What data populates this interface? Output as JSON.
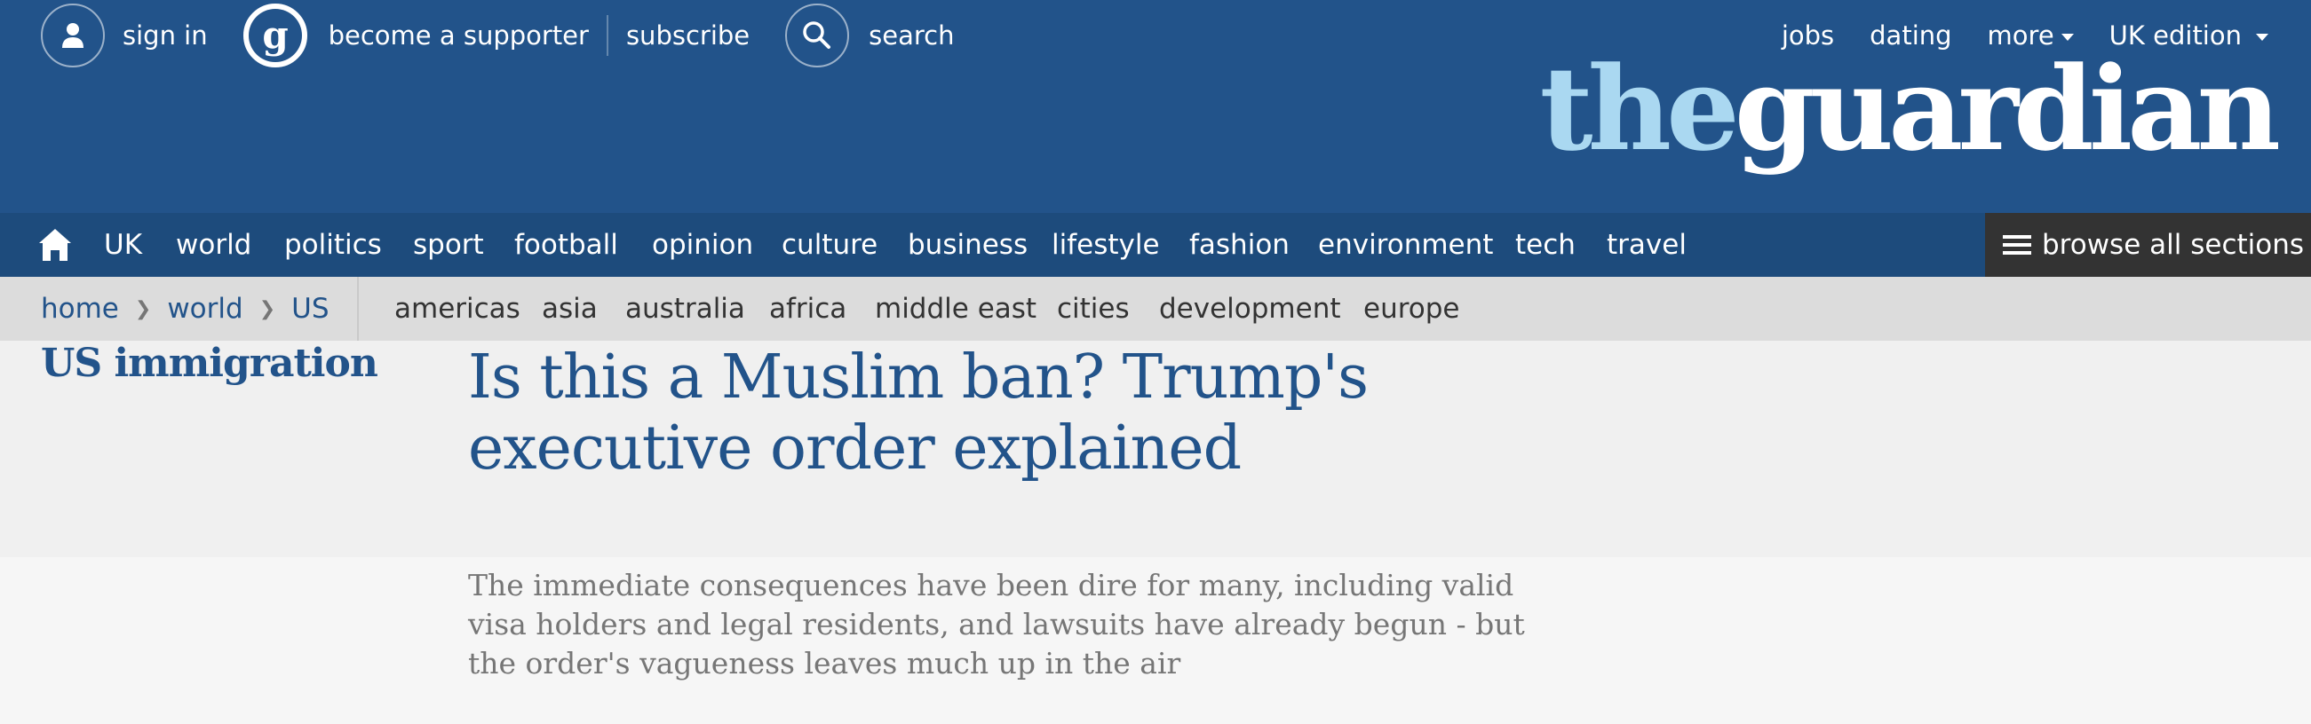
{
  "topbar": {
    "sign_in": "sign in",
    "become_supporter": "become a supporter",
    "subscribe": "subscribe",
    "search": "search",
    "jobs": "jobs",
    "dating": "dating",
    "more": "more",
    "edition": "UK edition"
  },
  "logo": {
    "the": "the",
    "guardian": "guardian"
  },
  "nav": {
    "items": [
      "UK",
      "world",
      "politics",
      "sport",
      "football",
      "opinion",
      "culture",
      "business",
      "lifestyle",
      "fashion",
      "environment",
      "tech",
      "travel"
    ],
    "browse_all": "browse all sections"
  },
  "breadcrumb": [
    "home",
    "world",
    "US"
  ],
  "subnav": [
    "americas",
    "asia",
    "australia",
    "africa",
    "middle east",
    "cities",
    "development",
    "europe"
  ],
  "article": {
    "section": "US immigration",
    "headline": "Is this a Muslim ban? Trump's executive order explained",
    "standfirst": "The immediate consequences have been dire for many, including valid visa holders and legal residents, and lawsuits have already begun - but the order's vagueness leaves much up in the air"
  },
  "colors": {
    "brand_blue": "#22538a",
    "nav_blue": "#1d4b7c",
    "logo_light": "#aad8f1",
    "browse_bg": "#333333"
  }
}
